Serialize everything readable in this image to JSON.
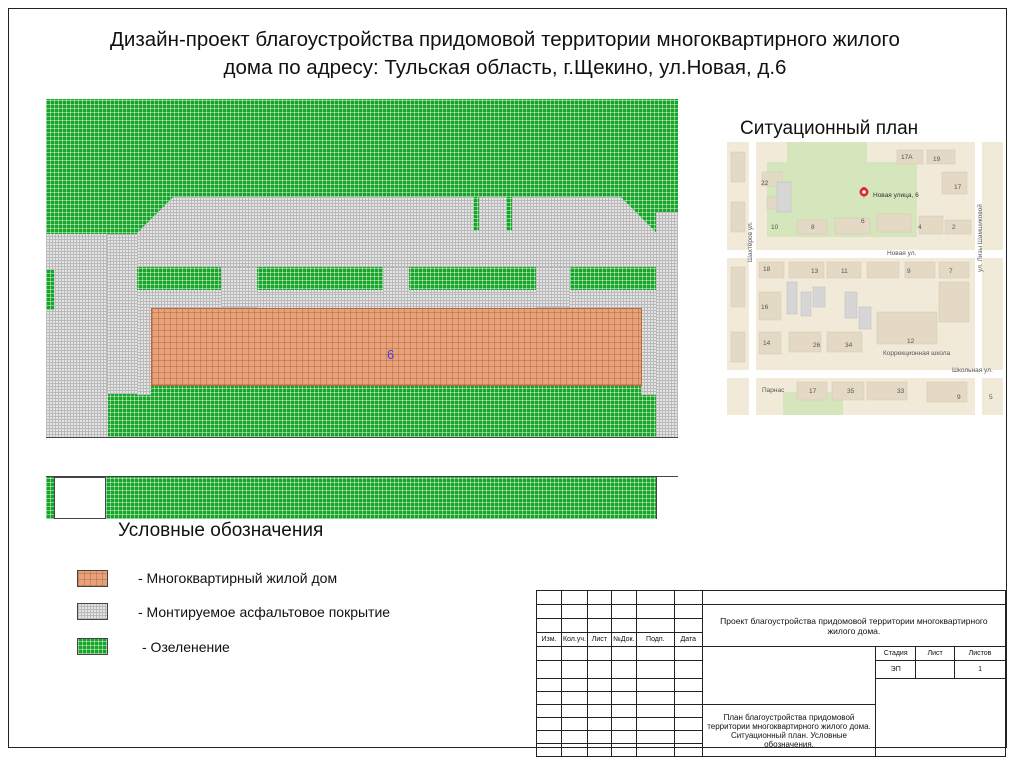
{
  "title_line1": "Дизайн-проект благоустройства придомовой территории многоквартирного жилого",
  "title_line2": "дома по адресу: Тульская область, г.Щекино, ул.Новая, д.6",
  "building_number": "6",
  "situation_plan": {
    "title": "Ситуационный план",
    "pin_label": "Новая улица, 6",
    "streets": {
      "novaya": "Новая ул.",
      "shakhterov": "Шахтёров ул.",
      "shamshikovoy": "ул. Лизы Шамшиковой",
      "shkolnaya": "Школьная ул."
    },
    "places": {
      "school": "Коррекционная школа",
      "park": "Парнас"
    },
    "house_numbers": [
      "17А",
      "19",
      "22",
      "17",
      "10",
      "8",
      "6",
      "4",
      "2",
      "18",
      "13",
      "11",
      "9",
      "7",
      "16",
      "14",
      "26",
      "34",
      "12",
      "17",
      "35",
      "33",
      "9",
      "5"
    ],
    "colors": {
      "background": "#f2ead9",
      "green": "#cfe3b4",
      "roads": "#ffffff",
      "pin": "#e3262b"
    }
  },
  "legend": {
    "title": "Условные обозначения",
    "items": [
      {
        "label": "- Многоквартирный жилой дом",
        "color": "#e8a27a"
      },
      {
        "label": "- Монтируемое асфальтовое покрытие",
        "color": "#e4e4e4"
      },
      {
        "label": "- Озеленение",
        "color": "#16a526"
      }
    ]
  },
  "stamp": {
    "col_headers": [
      "Изм.",
      "Кол.уч.",
      "Лист",
      "№Док.",
      "Подп.",
      "Дата"
    ],
    "project_title": "Проект благоустройства придомовой территории многоквартирного жилого дома.",
    "stage_header": "Стадия",
    "sheet_header": "Лист",
    "sheets_header": "Листов",
    "stage_value": "ЭП",
    "sheet_value": "",
    "sheets_value": "1",
    "sheet_title": "План благоустройства придомовой территории многоквартирного жилого дома. Ситуационный план. Условные обозначения."
  }
}
